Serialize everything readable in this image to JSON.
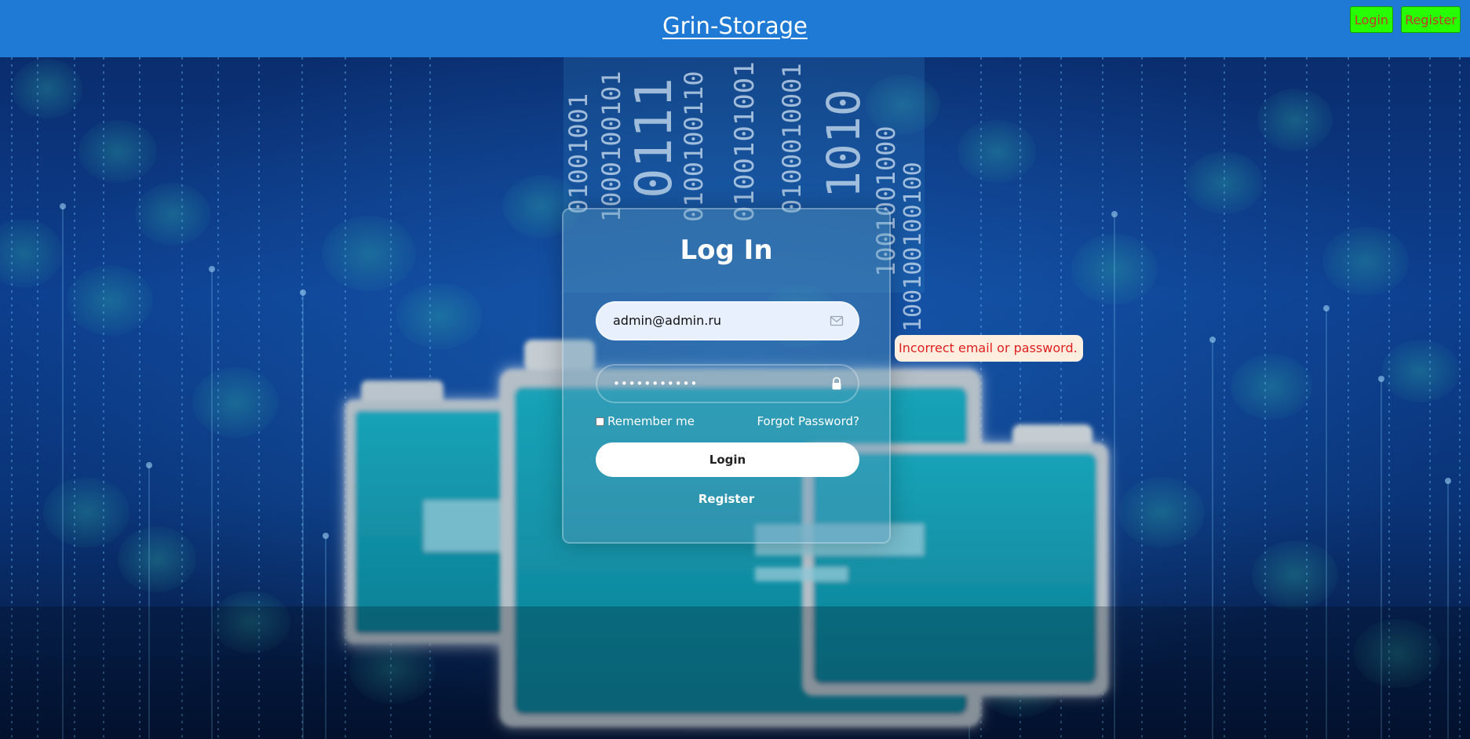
{
  "header": {
    "title": "Grin-Storage",
    "login_label": "Login",
    "register_label": "Register"
  },
  "login_form": {
    "heading": "Log In",
    "email_value": "admin@admin.ru",
    "password_mask": "•••••••••••",
    "remember_label": "Remember me",
    "remember_checked": false,
    "forgot_label": "Forgot Password?",
    "submit_label": "Login",
    "register_label": "Register",
    "email_icon": "envelope-icon",
    "password_icon": "lock-icon"
  },
  "error": {
    "message": "Incorrect email or password."
  },
  "colors": {
    "header_bg": "#1f7ad6",
    "header_button_bg": "#26ff00",
    "header_button_text": "#c0392b",
    "error_text": "#e02020",
    "error_bg": "#fdeee0"
  }
}
